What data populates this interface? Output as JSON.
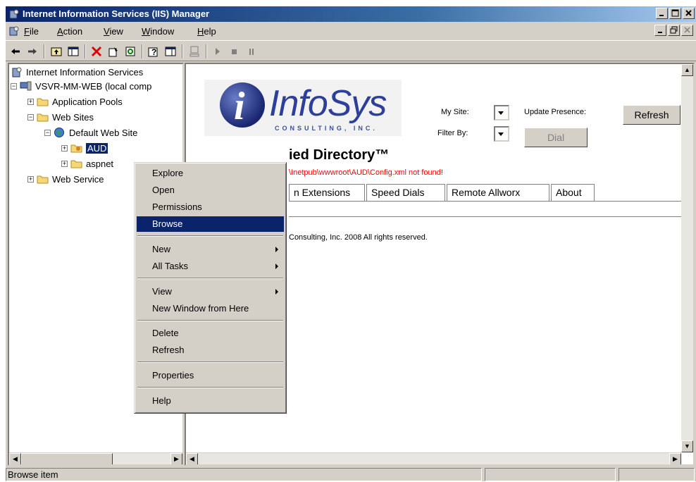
{
  "window": {
    "title": "Internet Information Services (IIS) Manager"
  },
  "menubar": {
    "items": [
      {
        "label": "File",
        "u": "F",
        "rest": "ile"
      },
      {
        "label": "Action",
        "u": "A",
        "rest": "ction"
      },
      {
        "label": "View",
        "u": "V",
        "rest": "iew"
      },
      {
        "label": "Window",
        "u": "W",
        "rest": "indow"
      },
      {
        "label": "Help",
        "u": "H",
        "rest": "elp"
      }
    ]
  },
  "tree": {
    "root": "Internet Information Services",
    "server": "VSVR-MM-WEB (local comp",
    "app_pools": "Application Pools",
    "web_sites": "Web Sites",
    "default_site": "Default Web Site",
    "aud": "AUD",
    "aspnet": "aspnet",
    "web_service": "Web Service"
  },
  "context_menu": {
    "items": {
      "explore": "Explore",
      "open": "Open",
      "permissions": "Permissions",
      "browse": "Browse",
      "new": "New",
      "all_tasks": "All Tasks",
      "view": "View",
      "new_window": "New Window from Here",
      "delete": "Delete",
      "refresh": "Refresh",
      "properties": "Properties",
      "help": "Help"
    }
  },
  "content": {
    "logo_text": "InfoSys",
    "logo_sub": "CONSULTING, INC.",
    "my_site_label": "My Site:",
    "update_presence_label": "Update Presence:",
    "filter_by_label": "Filter By:",
    "refresh_btn": "Refresh",
    "dial_btn": "Dial",
    "heading": "ied Directory™",
    "error": "\\Inetpub\\wwwroot\\AUD\\Config.xml not found!",
    "tabs": [
      "n Extensions",
      "Speed Dials",
      "Remote Allworx",
      "About"
    ],
    "copyright": "Consulting, Inc. 2008 All rights reserved."
  },
  "status": {
    "text": "Browse item"
  },
  "colors": {
    "title_start": "#0a246a",
    "selection": "#0a246a",
    "error": "#ff0000",
    "face": "#d4d0c8"
  }
}
